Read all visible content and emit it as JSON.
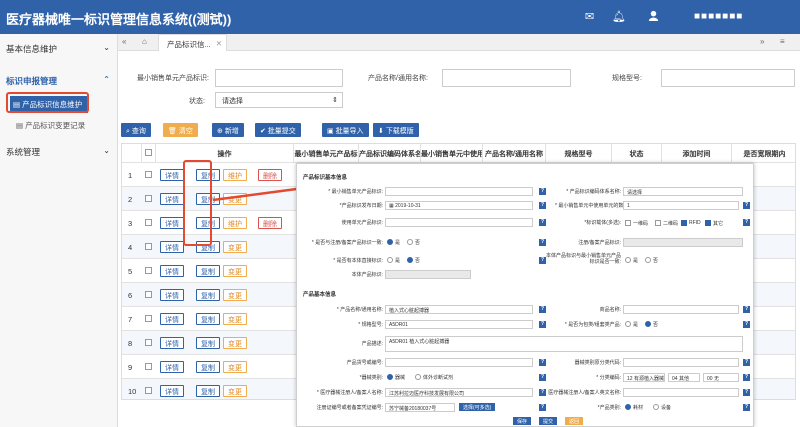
{
  "app": {
    "title": "医疗器械唯一标识管理信息系统((测试))",
    "user": "■■■■■■■"
  },
  "icons": {
    "menu": "menu-icon",
    "mail": "mail-icon",
    "bell": "bell-icon",
    "user": "user-icon"
  },
  "sidebar": {
    "groups": [
      {
        "label": "基本信息维护"
      },
      {
        "label": "标识申报管理",
        "items": [
          {
            "label": "产品标识信息维护",
            "active": true
          },
          {
            "label": "产品标识变更记录"
          }
        ]
      },
      {
        "label": "系统管理"
      }
    ]
  },
  "tabs": {
    "active": "产品标识信..."
  },
  "filters": {
    "min_unit_label": "最小销售单元产品标识:",
    "product_name_label": "产品名称/通用名称:",
    "model_label": "规格型号:",
    "status_label": "状态:",
    "status_value": "请选择"
  },
  "toolbar": {
    "query": "查询",
    "clear": "清空",
    "add": "新增",
    "batch_submit": "批量提交",
    "batch_import": "批量导入",
    "download": "下载模版"
  },
  "table": {
    "columns": [
      "操作",
      "最小销售单元产品标",
      "产品标识编码体系名",
      "最小销售单元中使用",
      "产品名称/通用名称",
      "规格型号",
      "状态",
      "添加时间",
      "是否宽限期内"
    ],
    "rows": [
      {
        "no": "1",
        "actions": [
          "详情",
          "复制",
          "维护",
          "删除"
        ]
      },
      {
        "no": "2",
        "actions": [
          "详情",
          "复制",
          "变更"
        ]
      },
      {
        "no": "3",
        "actions": [
          "详情",
          "复制",
          "维护",
          "删除"
        ]
      },
      {
        "no": "4",
        "actions": [
          "详情",
          "复制",
          "变更"
        ]
      },
      {
        "no": "5",
        "actions": [
          "详情",
          "复制",
          "变更"
        ]
      },
      {
        "no": "6",
        "actions": [
          "详情",
          "复制",
          "变更"
        ]
      },
      {
        "no": "7",
        "actions": [
          "详情",
          "复制",
          "变更"
        ]
      },
      {
        "no": "8",
        "actions": [
          "详情",
          "复制",
          "变更"
        ]
      },
      {
        "no": "9",
        "actions": [
          "详情",
          "复制",
          "变更"
        ]
      },
      {
        "no": "10",
        "actions": [
          "详情",
          "复制",
          "变更"
        ]
      }
    ]
  },
  "panel": {
    "section1": "产品标识基本信息",
    "section2": "产品基本信息",
    "fields": {
      "min_unit_id": "* 最小销售单元产品标识:",
      "coding_system": "* 产品标识编码体系名称:",
      "coding_system_value": "请选择",
      "release_date": "*产品标识发布日期:",
      "release_date_value": "2019-10-31",
      "min_unit_count": "* 最小销售单元中使用单元的数量:",
      "min_unit_count_value": "1",
      "use_unit_id": "使用单元产品标识:",
      "carrier": "*标识载体(多选):",
      "carrier_options": [
        "一维码",
        "二维码",
        "RFID",
        "其它"
      ],
      "same_as_reg": "* 是否与注册/备案产品标识一致:",
      "yes": "是",
      "no": "否",
      "reg_product_id": "注册/备案产品标识:",
      "has_body_mark": "* 是否有本体直接标识:",
      "body_consistent": "本体产品标识与最小销售单元产品标识是否一致:",
      "body_id": "本体产品标识:",
      "product_name": "* 产品名称/通用名称:",
      "product_name_value": "植入式心脏起搏器",
      "trade_name": "商品名称:",
      "model": "* 规格型号:",
      "model_value": "A5DR01",
      "is_kit": "* 是否为包类/组套类产品:",
      "description": "产品描述:",
      "description_value": "A5DR01 植入式心脏起搏器",
      "catalog_code": "产品货号或编号:",
      "original_code": "器械类别原分类代码:",
      "device_type": "*器械类别:",
      "device_type_options": [
        "器械",
        "体外诊断试剂"
      ],
      "class_code": "* 分类编码:",
      "class_code_value": "12 有源植入器械",
      "class_code_value2": "04 其他",
      "class_code_value3": "00 无",
      "registrant": "* 医疗器械注册人/备案人名称:",
      "registrant_value": "江苏利拉迈医疗科技发展有限公司",
      "registrant_en": "医疗器械注册人/备案人英文名称:",
      "reg_cert": "注册证编号或者备案凭证编号:",
      "reg_cert_value": "苏宁械备20180037号",
      "select_btn": "选择(可多选)",
      "product_type": "*产品类别:",
      "product_type_options": [
        "耗材",
        "设备"
      ]
    },
    "buttons": {
      "save": "保存",
      "submit": "提交",
      "back": "返回"
    }
  },
  "colors": {
    "brand": "#2f62a9",
    "highlight": "#e34a2f",
    "warning": "#f0ad4e",
    "danger": "#d9534f"
  }
}
